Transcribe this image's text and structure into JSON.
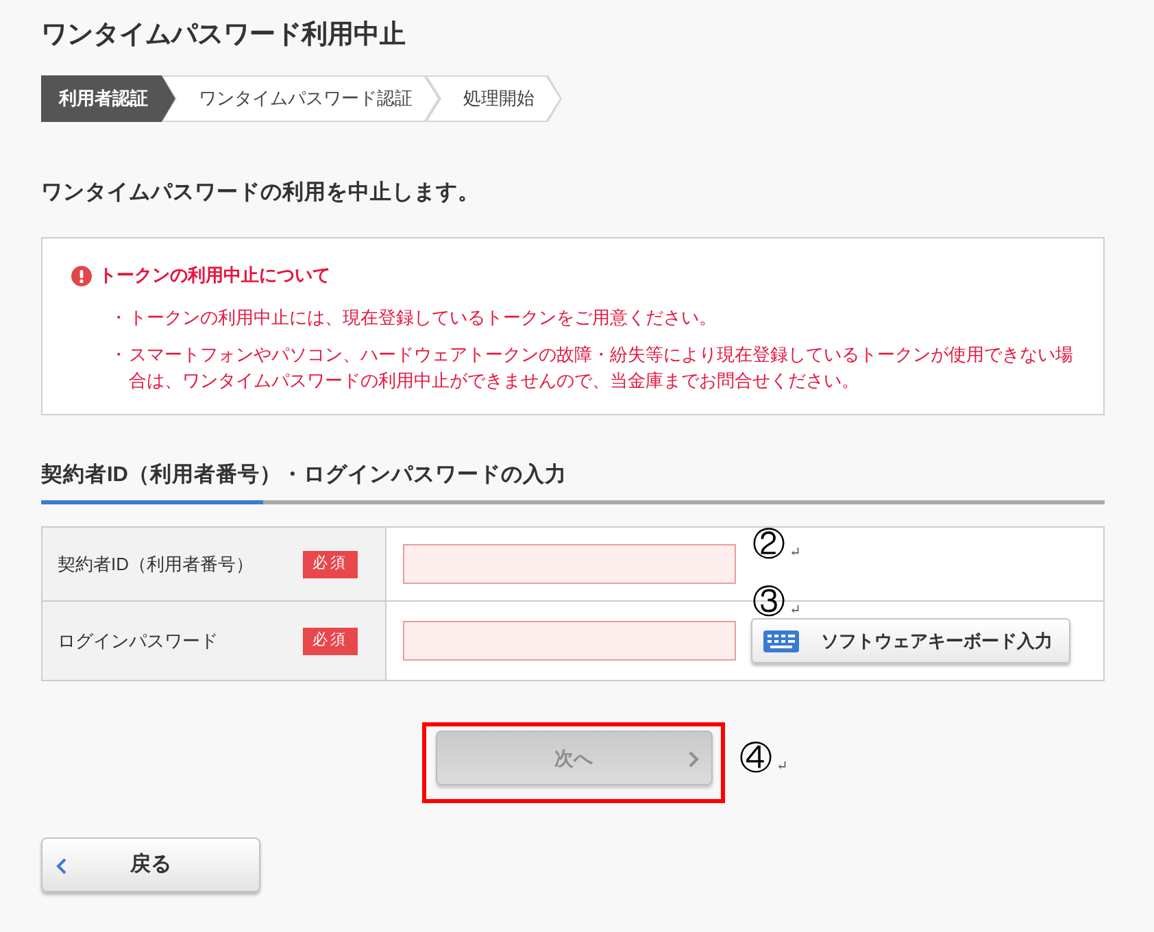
{
  "page": {
    "title": "ワンタイムパスワード利用中止"
  },
  "steps": [
    {
      "label": "利用者認証",
      "selected": true
    },
    {
      "label": "ワンタイムパスワード認証",
      "selected": false
    },
    {
      "label": "処理開始",
      "selected": false
    }
  ],
  "intro": "ワンタイムパスワードの利用を中止します。",
  "notice": {
    "heading": "トークンの利用中止について",
    "items": [
      {
        "marker": "・",
        "text": "トークンの利用中止には、現在登録しているトークンをご用意ください。"
      },
      {
        "marker": "・",
        "text": "スマートフォンやパソコン、ハードウェアトークンの故障・紛失等により現在登録しているトークンが使用できない場合は、ワンタイムパスワードの利用中止ができませんので、当金庫までお問合せください。"
      }
    ]
  },
  "form": {
    "heading": "契約者ID（利用者番号）・ログインパスワードの入力",
    "fields": [
      {
        "label": "契約者ID（利用者番号）",
        "required_badge": "必須",
        "annotation": {
          "number": "②",
          "return_mark": "↵"
        }
      },
      {
        "label": "ログインパスワード",
        "required_badge": "必須",
        "keyboard_button": "ソフトウェアキーボード入力",
        "annotation": {
          "number": "③",
          "return_mark": "↵"
        }
      }
    ]
  },
  "next_button": {
    "label": "次へ",
    "disabled": true,
    "highlighted": true,
    "annotation": {
      "number": "④",
      "return_mark": "↵"
    }
  },
  "back_button": {
    "label": "戻る"
  }
}
